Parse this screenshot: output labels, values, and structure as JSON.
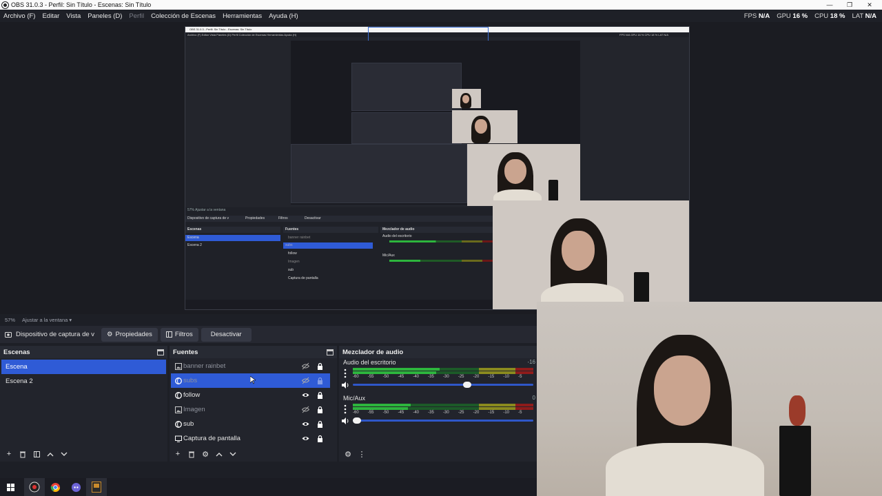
{
  "window": {
    "title": "OBS 31.0.3 - Perfil: Sin Título - Escenas: Sin Título",
    "min": "—",
    "max": "❐",
    "close": "✕"
  },
  "menu": [
    {
      "label": "Archivo (F)",
      "enabled": true
    },
    {
      "label": "Editar",
      "enabled": true
    },
    {
      "label": "Vista",
      "enabled": true
    },
    {
      "label": "Paneles (D)",
      "enabled": true
    },
    {
      "label": "Perfil",
      "enabled": false
    },
    {
      "label": "Colección de Escenas",
      "enabled": true
    },
    {
      "label": "Herramientas",
      "enabled": true
    },
    {
      "label": "Ayuda (H)",
      "enabled": true
    }
  ],
  "stats": {
    "fps_label": "FPS",
    "fps_value": "N/A",
    "gpu_label": "GPU",
    "gpu_value": "16 %",
    "cpu_label": "CPU",
    "cpu_value": "18 %",
    "lat_label": "LAT",
    "lat_value": "N/A"
  },
  "zoom": {
    "value": "57%",
    "mode": "Ajustar a la ventana"
  },
  "context_bar": {
    "source": "Dispositivo de captura de v",
    "properties": "Propiedades",
    "filters": "Filtros",
    "deactivate": "Desactivar"
  },
  "scenes": {
    "title": "Escenas",
    "items": [
      {
        "label": "Escena",
        "selected": true
      },
      {
        "label": "Escena 2",
        "selected": false
      }
    ]
  },
  "sources": {
    "title": "Fuentes",
    "items": [
      {
        "label": "banner rainbet",
        "icon": "image-icon",
        "visible": false,
        "selected": false
      },
      {
        "label": "subs",
        "icon": "browser-icon",
        "visible": false,
        "selected": true
      },
      {
        "label": "follow",
        "icon": "browser-icon",
        "visible": true,
        "selected": false
      },
      {
        "label": "Imagen",
        "icon": "image-icon",
        "visible": false,
        "selected": false
      },
      {
        "label": "sub",
        "icon": "browser-icon",
        "visible": true,
        "selected": false
      },
      {
        "label": "Captura de pantalla",
        "icon": "monitor-icon",
        "visible": true,
        "selected": false
      }
    ]
  },
  "mixer": {
    "title": "Mezclador de audio",
    "tracks": [
      {
        "name": "Audio del escritorio",
        "db": "-16",
        "level": 0.48,
        "volume": 0.64
      },
      {
        "name": "Mic/Aux",
        "db": "0",
        "level": 0.32,
        "volume": 0.0
      }
    ],
    "scale": [
      "-60",
      "-55",
      "-50",
      "-45",
      "-40",
      "-35",
      "-30",
      "-25",
      "-20",
      "-15",
      "-10",
      "-5"
    ]
  },
  "inner": {
    "title": "OBS 31.0.3 - Perfil: Sin Título - Escenas: Sin Título",
    "menu": "Archivo (F)   Editar   Vista   Paneles (D)   Perfil   Colección de Escenas   Herramientas   Ayuda (H)",
    "stats": "FPS N/A   GPU 16 %   CPU 18 %   LAT N/A",
    "zoom": "57%   Ajustar a la ventana",
    "ctx": "Dispositivo de captura de v",
    "props": "Propiedades",
    "filters": "Filtros",
    "deact": "Desactivar",
    "scenes_title": "Escenas",
    "scene1": "Escena",
    "scene2": "Escena 2",
    "sources_title": "Fuentes",
    "src": [
      "banner rainbet",
      "subs",
      "follow",
      "Imagen",
      "sub",
      "Captura de pantalla"
    ],
    "mixer_title": "Mezclador de audio",
    "track1": "Audio del escritorio",
    "track2": "Mic/Aux"
  },
  "colors": {
    "accent": "#2f5bd6",
    "meter_green": "#2db53d",
    "meter_yellow": "#8a8a1f",
    "meter_red": "#8e1b1b"
  }
}
